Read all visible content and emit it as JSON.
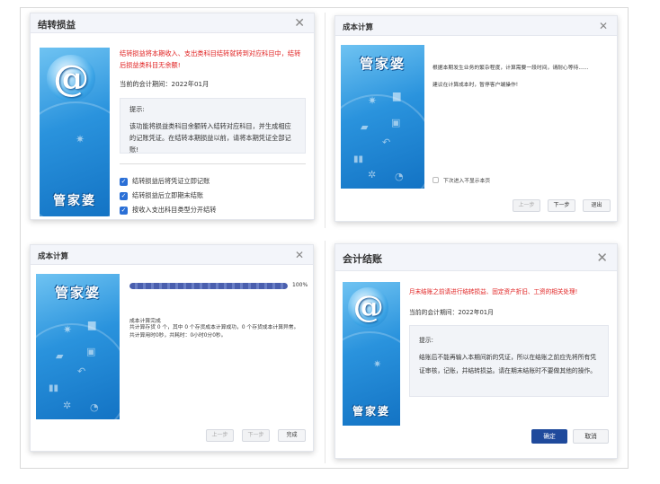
{
  "colors": {
    "accent": "#1f4a9c",
    "warning_red": "#e02020",
    "check_blue": "#2a6fd6",
    "panel_blue": "#2a93dd"
  },
  "brand": {
    "name": "管家婆",
    "logo_glyph": "@"
  },
  "dialog1": {
    "title": "结转损益",
    "warning": "结转损益将本期收入、支出类科目结转就转到对应科目中，结转后损益类科目无余额!",
    "period": "当前的会计期间：2022年01月",
    "hint_title": "提示:",
    "hint_body": "该功能将损益类科目余额转入结转对应科目，并生成相应的记账凭证。在结转本期损益以前，请将本期凭证全部记账!",
    "options": [
      {
        "label": "结转损益后将凭证立即记账",
        "checked": true
      },
      {
        "label": "结转损益后立即期末结账",
        "checked": true
      },
      {
        "label": "按收入支出科目类型分开结转",
        "checked": true
      }
    ]
  },
  "dialog2": {
    "title": "成本计算",
    "line1": "根据本期发生业务的繁杂程度，计算需要一段时间，请耐心等待......",
    "line2": "建议在计算成本时，暂停客户端操作!",
    "no_show_label": "下次进入不显示本页",
    "buttons": {
      "prev": "上一步",
      "next": "下一步",
      "exit": "退出"
    }
  },
  "dialog3": {
    "title": "成本计算",
    "progress_percent": 100,
    "progress_label": "100%",
    "result_title": "成本计算完成",
    "result_body": "共计算存货 0 个，其中 0 个存货成本计算成功，0 个存货成本计算异常。共计算用时0秒，共耗时：0小时0分0秒。",
    "buttons": {
      "prev": "上一步",
      "next": "下一步",
      "finish": "完成"
    }
  },
  "dialog4": {
    "title": "会计结账",
    "warning": "月末结账之前请进行结转损益、固定资产折旧、工资的相关处理!",
    "period": "当前的会计期间：2022年01月",
    "hint_title": "提示:",
    "hint_body": "结账后不能再输入本期间新的凭证，所以在结账之前应先将所有凭证审核，记账，并结转损益。请在期末结账时不要做其他的操作。",
    "buttons": {
      "ok": "确定",
      "cancel": "取消"
    }
  }
}
